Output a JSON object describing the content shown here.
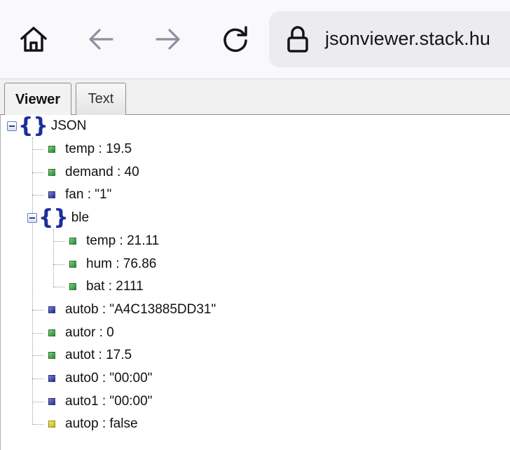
{
  "browser": {
    "url": "jsonviewer.stack.hu",
    "icons": [
      "home-icon",
      "back-arrow-icon",
      "forward-arrow-icon",
      "reload-icon",
      "lock-icon"
    ]
  },
  "tabs": [
    {
      "label": "Viewer",
      "active": true
    },
    {
      "label": "Text",
      "active": false
    }
  ],
  "tree": {
    "root": "JSON",
    "items": [
      {
        "text": "temp : 19.5",
        "kind": "number"
      },
      {
        "text": "demand : 40",
        "kind": "number"
      },
      {
        "text": "fan : \"1\"",
        "kind": "string"
      },
      {
        "text": "ble",
        "kind": "object",
        "children": [
          {
            "text": "temp : 21.11",
            "kind": "number"
          },
          {
            "text": "hum : 76.86",
            "kind": "number"
          },
          {
            "text": "bat : 2111",
            "kind": "number"
          }
        ]
      },
      {
        "text": "autob : \"A4C13885DD31\"",
        "kind": "string"
      },
      {
        "text": "autor : 0",
        "kind": "number"
      },
      {
        "text": "autot : 17.5",
        "kind": "number"
      },
      {
        "text": "auto0 : \"00:00\"",
        "kind": "string"
      },
      {
        "text": "auto1 : \"00:00\"",
        "kind": "string"
      },
      {
        "text": "autop : false",
        "kind": "boolean"
      }
    ]
  },
  "colors": {
    "number": "#2e9a3a",
    "string": "#2a3690",
    "boolean": "#d4c21a",
    "brace": "#1c2f9c"
  }
}
